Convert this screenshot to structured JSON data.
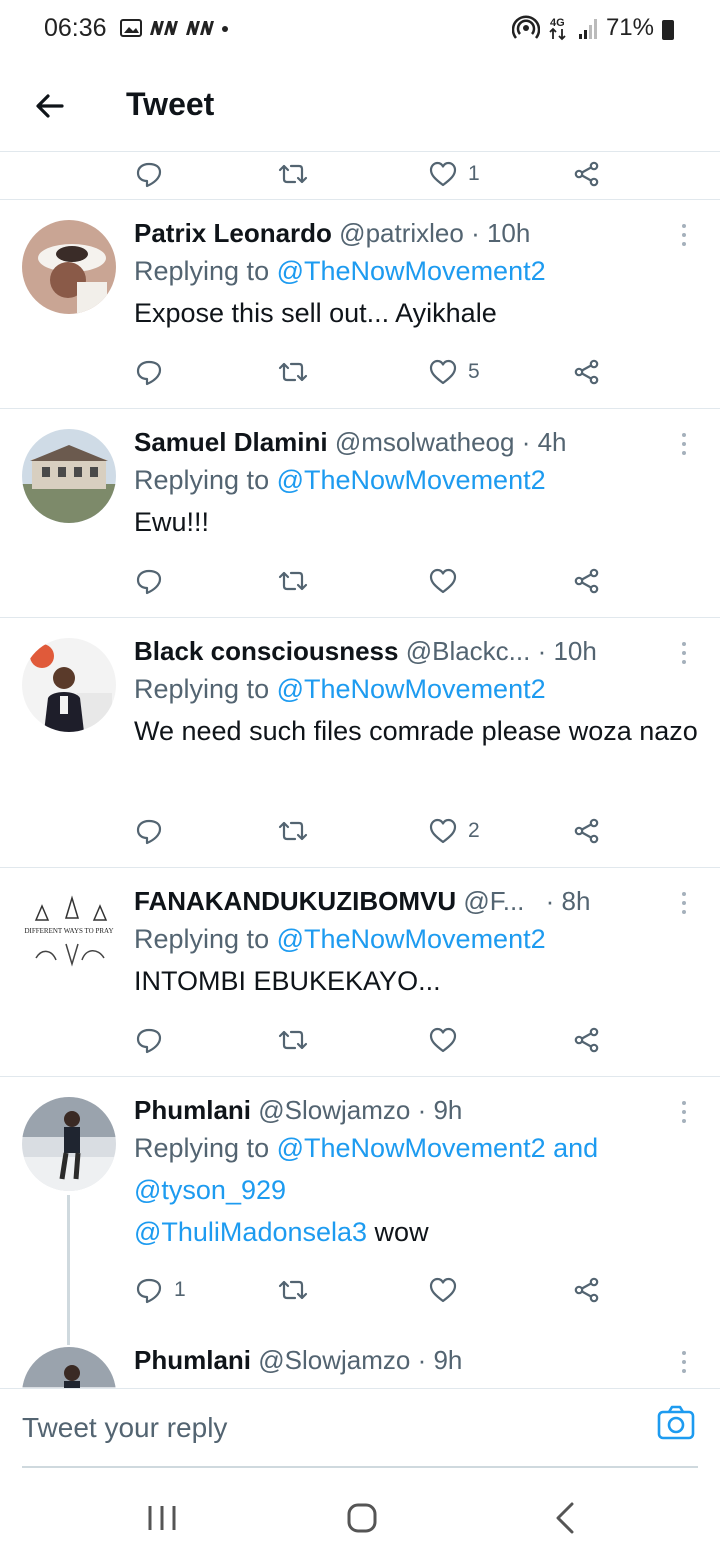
{
  "status_bar": {
    "time": "06:36",
    "battery": "71%",
    "network": "4G"
  },
  "header": {
    "title": "Tweet"
  },
  "top_actions": {
    "likes": "1"
  },
  "tweets": [
    {
      "name": "Patrix Leonardo",
      "handle": "@patrixleo",
      "time": "· 10h",
      "replying_prefix": "Replying to ",
      "replying_to": "@TheNowMovement2",
      "text": "Expose this sell out... Ayikhale",
      "replies": "",
      "likes": "5"
    },
    {
      "name": "Samuel Dlamini",
      "handle": "@msolwatheog",
      "time": "· 4h",
      "replying_prefix": "Replying to ",
      "replying_to": "@TheNowMovement2",
      "text": "Ewu!!!",
      "replies": "",
      "likes": ""
    },
    {
      "name": "Black consciousness",
      "handle": "@Blackc...",
      "time": "· 10h",
      "replying_prefix": "Replying to ",
      "replying_to": "@TheNowMovement2",
      "text": "We need such files comrade please woza nazo",
      "replies": "",
      "likes": "2"
    },
    {
      "name": "FANAKANDUKUZIBOMVU",
      "handle": "@F...",
      "time": "· 8h",
      "replying_prefix": "Replying to ",
      "replying_to": "@TheNowMovement2",
      "text": "INTOMBI EBUKEKAYO...",
      "replies": "",
      "likes": "",
      "avatar_text": "DIFFERENT WAYS TO PRAY"
    },
    {
      "name": "Phumlani",
      "handle": "@Slowjamzo",
      "time": "· 9h",
      "replying_prefix": "Replying to ",
      "replying_to": "@TheNowMovement2",
      "replying_and": " and",
      "replying_to_2": "@tyson_929",
      "mention_3": "@ThuliMadonsela3",
      "text": " wow",
      "replies": "1",
      "likes": ""
    },
    {
      "name": "Phumlani",
      "handle": "@Slowjamzo",
      "time": "· 9h"
    }
  ],
  "reply_bar": {
    "placeholder": "Tweet your reply"
  },
  "colors": {
    "accent": "#1d9bf0",
    "secondary_text": "#536471",
    "divider": "#e1e8ed"
  }
}
